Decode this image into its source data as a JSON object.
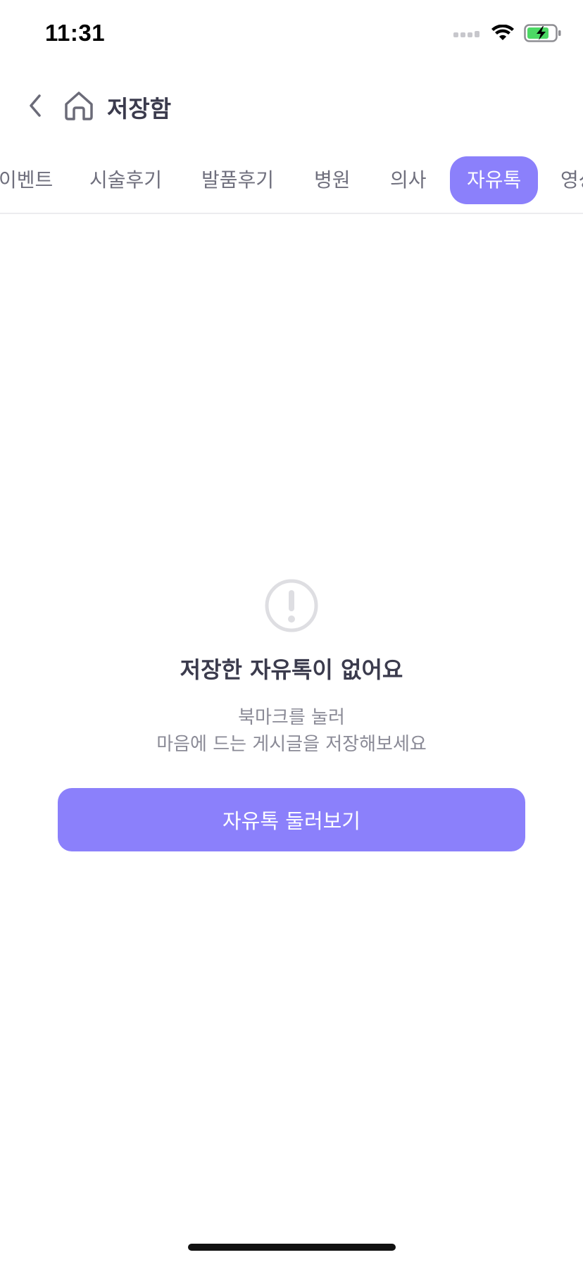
{
  "status_bar": {
    "time": "11:31",
    "icons": [
      "signal-icon",
      "wifi-icon",
      "battery-charging-icon"
    ]
  },
  "header": {
    "title": "저장함",
    "back_icon": "chevron-left-icon",
    "home_icon": "home-icon"
  },
  "tabs": [
    {
      "label": "이벤트",
      "active": false
    },
    {
      "label": "시술후기",
      "active": false
    },
    {
      "label": "발품후기",
      "active": false
    },
    {
      "label": "병원",
      "active": false
    },
    {
      "label": "의사",
      "active": false
    },
    {
      "label": "자유톡",
      "active": true
    },
    {
      "label": "영상",
      "active": false
    }
  ],
  "empty_state": {
    "icon": "exclamation-circle-icon",
    "title": "저장한 자유톡이 없어요",
    "desc_line1": "북마크를 눌러",
    "desc_line2": "마음에 드는 게시글을 저장해보세요",
    "button_label": "자유톡 둘러보기"
  },
  "colors": {
    "accent": "#8b80fb",
    "title_text": "#3b3b4d",
    "muted_text": "#8a8a96",
    "tab_text": "#6f6f7d",
    "battery_green": "#4cd964"
  }
}
